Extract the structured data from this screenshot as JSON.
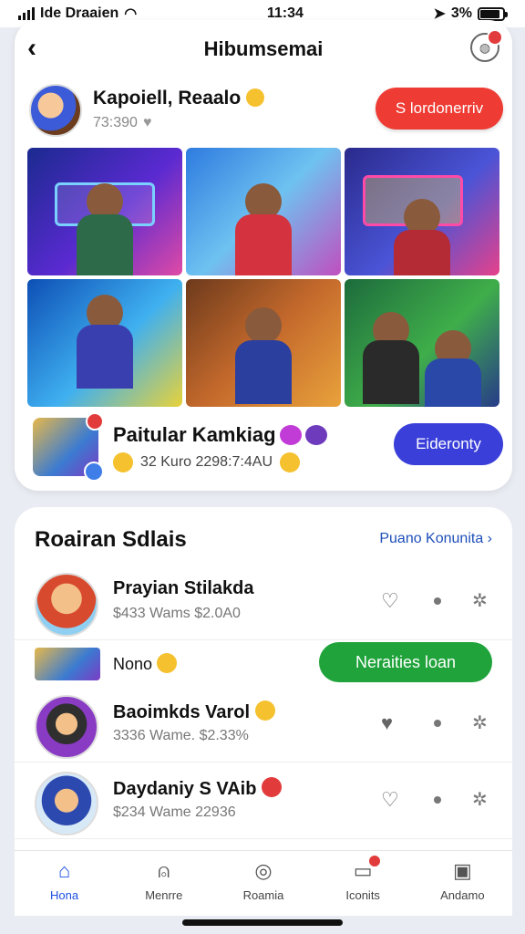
{
  "status_bar": {
    "carrier": "Ide Draaien",
    "time": "11:34",
    "battery": "3%"
  },
  "header": {
    "title": "Hibumsemai"
  },
  "profile": {
    "name": "Kapoiell, Reaalo",
    "sub": "73:390"
  },
  "primary_action": {
    "label": "S lordonerriv",
    "color": "#ee3b33"
  },
  "feature": {
    "title": "Paitular Kamkiag",
    "sub": "32 Kuro 2298:7:4AU",
    "button": "Eideronty",
    "button_color": "#3a3fd9"
  },
  "section": {
    "title": "Roairan Sdlais",
    "link": "Puano Konunita"
  },
  "rows": [
    {
      "name": "Prayian Stilakda",
      "sub": "$433 Wams $2.0A0"
    },
    {
      "name": "Baoimkds Varol",
      "sub": "3336 Wame. $2.33%"
    },
    {
      "name": "Daydaniy S VAib",
      "sub": "$234 Wame 22936"
    }
  ],
  "mini_row": {
    "label": "Nono",
    "button": "Neraities loan",
    "button_color": "#1fa33a"
  },
  "tabs": [
    {
      "label": "Hona",
      "icon": "home-icon"
    },
    {
      "label": "Menrre",
      "icon": "bell-icon"
    },
    {
      "label": "Roamia",
      "icon": "compass-icon"
    },
    {
      "label": "Iconits",
      "icon": "chat-icon"
    },
    {
      "label": "Andamo",
      "icon": "bag-icon"
    }
  ]
}
